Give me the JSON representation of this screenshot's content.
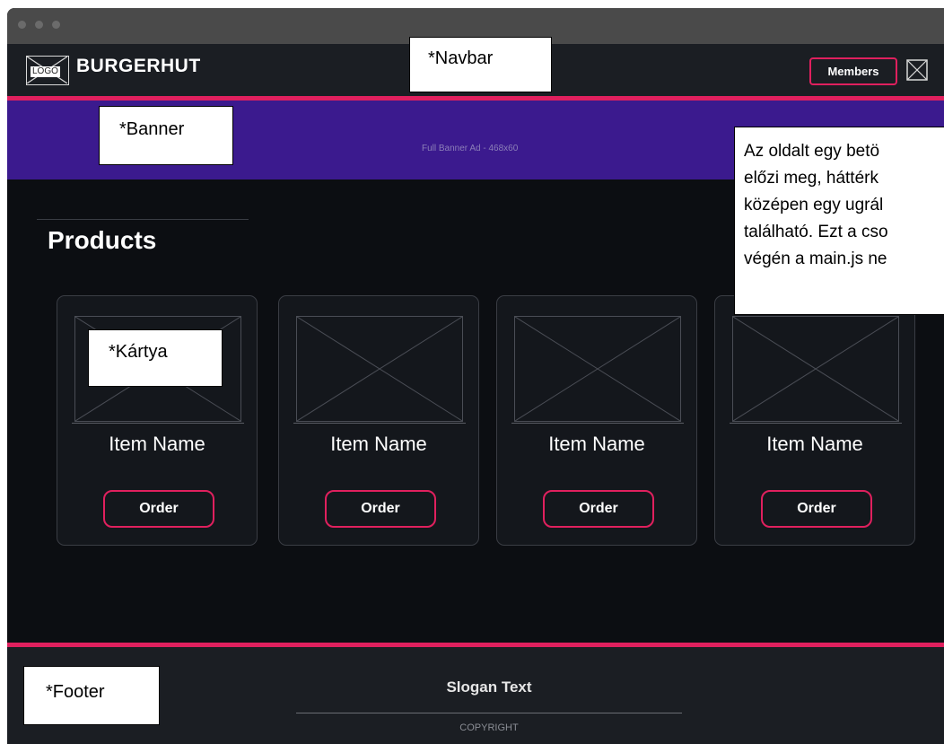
{
  "navbar": {
    "logo_text": "LOGO",
    "brand": "BURGERHUT",
    "members_label": "Members"
  },
  "banner": {
    "ad_text": "Full Banner Ad - 468x60"
  },
  "products": {
    "title": "Products",
    "cards": [
      {
        "name": "Item Name",
        "order_label": "Order"
      },
      {
        "name": "Item Name",
        "order_label": "Order"
      },
      {
        "name": "Item Name",
        "order_label": "Order"
      },
      {
        "name": "Item Name",
        "order_label": "Order"
      }
    ]
  },
  "footer": {
    "slogan": "Slogan Text",
    "copyright": "COPYRIGHT"
  },
  "annotations": {
    "navbar": "*Navbar",
    "banner": "*Banner",
    "card": "*Kártya",
    "footer": "*Footer",
    "popup_lines": [
      "Az oldalt egy betö",
      "előzi meg, háttérk",
      "középen egy ugrál",
      "található. Ezt a cso",
      "végén a main.js ne"
    ]
  },
  "colors": {
    "accent": "#e0205e",
    "banner": "#3b1a8e",
    "page_background": "#0c0e12",
    "navbar_background": "#1b1e23"
  }
}
